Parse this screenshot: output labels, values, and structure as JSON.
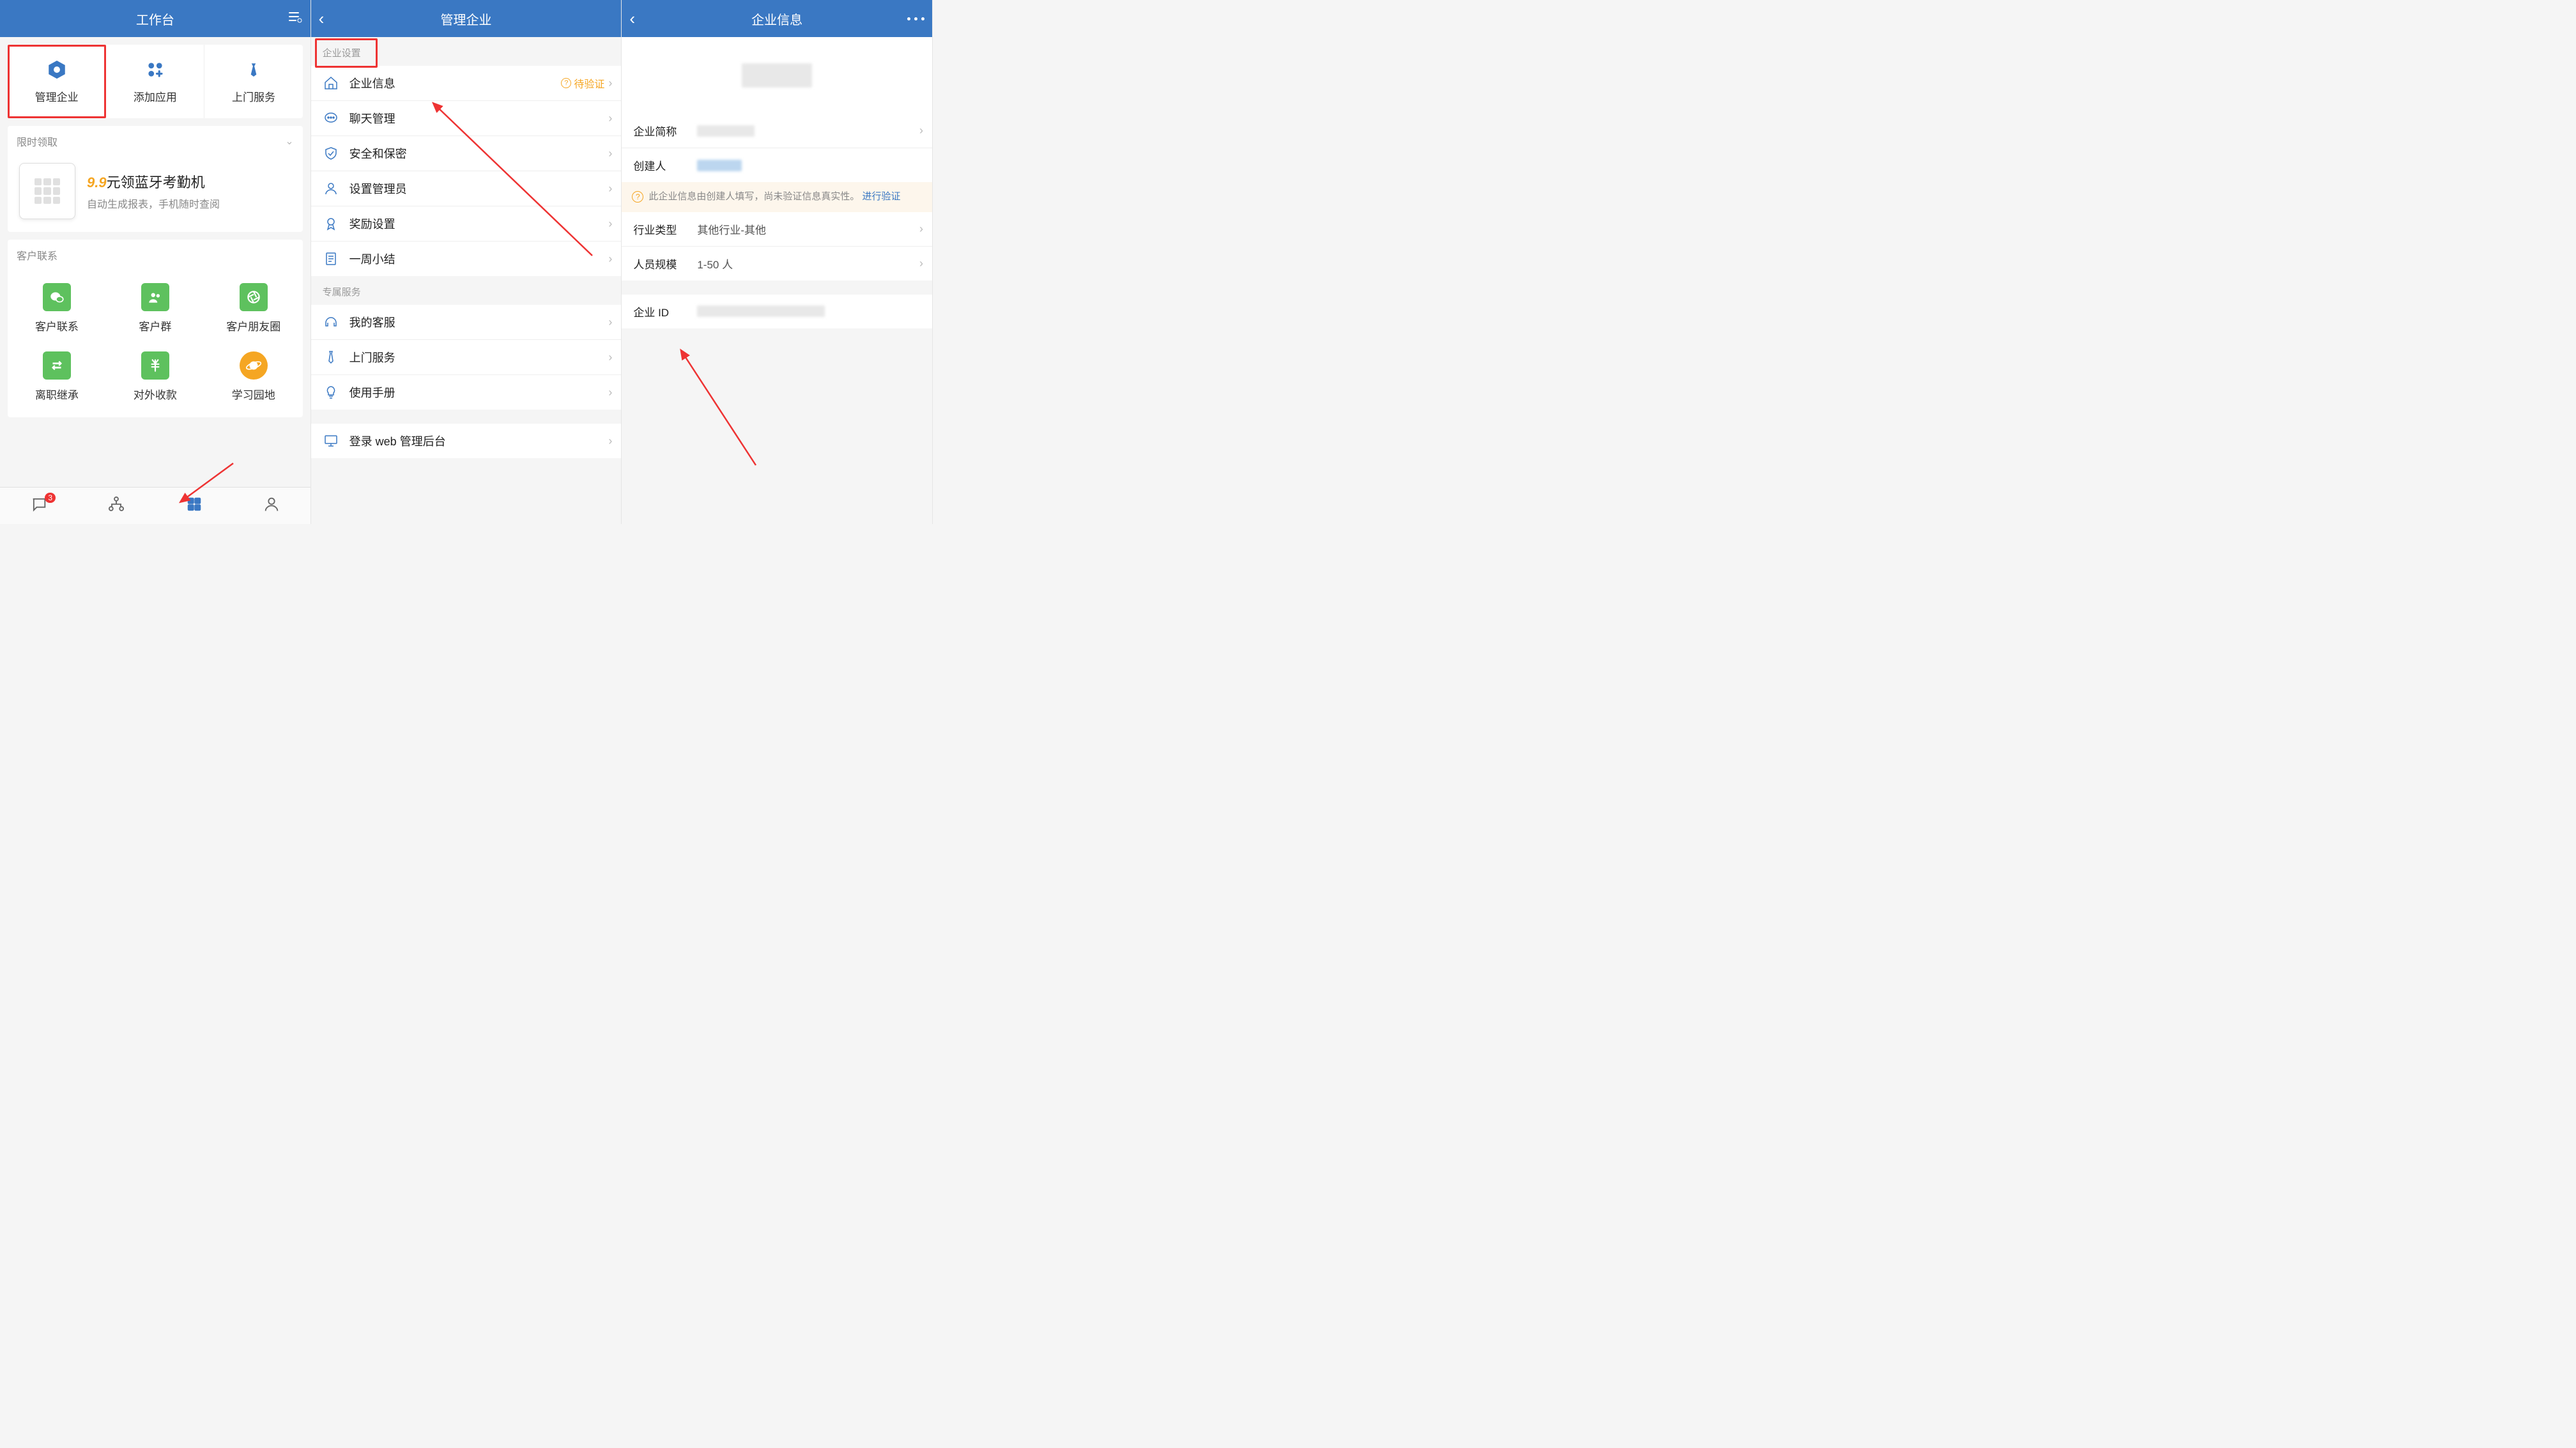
{
  "screen1": {
    "title": "工作台",
    "topGrid": [
      {
        "label": "管理企业",
        "icon": "gear-hex"
      },
      {
        "label": "添加应用",
        "icon": "add-app"
      },
      {
        "label": "上门服务",
        "icon": "tie"
      }
    ],
    "limited": {
      "header": "限时领取",
      "promoPrice": "9.9",
      "promoUnit": "元",
      "promoTitleRest": "领蓝牙考勤机",
      "promoSub": "自动生成报表，手机随时查阅"
    },
    "customer": {
      "header": "客户联系",
      "items": [
        {
          "label": "客户联系",
          "icon": "wechat",
          "color": "green"
        },
        {
          "label": "客户群",
          "icon": "group",
          "color": "green"
        },
        {
          "label": "客户朋友圈",
          "icon": "aperture",
          "color": "green"
        },
        {
          "label": "离职继承",
          "icon": "swap",
          "color": "green"
        },
        {
          "label": "对外收款",
          "icon": "cny",
          "color": "green"
        },
        {
          "label": "学习园地",
          "icon": "planet",
          "color": "orange"
        }
      ]
    },
    "badgeCount": "3"
  },
  "screen2": {
    "title": "管理企业",
    "groups": [
      {
        "label": "企业设置",
        "rows": [
          {
            "label": "企业信息",
            "icon": "home",
            "status": "待验证"
          },
          {
            "label": "聊天管理",
            "icon": "chat"
          },
          {
            "label": "安全和保密",
            "icon": "shield"
          },
          {
            "label": "设置管理员",
            "icon": "user"
          },
          {
            "label": "奖励设置",
            "icon": "medal"
          },
          {
            "label": "一周小结",
            "icon": "doc"
          }
        ]
      },
      {
        "label": "专属服务",
        "rows": [
          {
            "label": "我的客服",
            "icon": "headset"
          },
          {
            "label": "上门服务",
            "icon": "tie"
          },
          {
            "label": "使用手册",
            "icon": "bulb"
          }
        ]
      },
      {
        "label": "",
        "rows": [
          {
            "label": "登录 web 管理后台",
            "icon": "monitor"
          }
        ]
      }
    ]
  },
  "screen3": {
    "title": "企业信息",
    "rows1": [
      {
        "label": "企业简称",
        "valueBlur": true
      },
      {
        "label": "创建人",
        "valueBlur": true
      }
    ],
    "noticeText": "此企业信息由创建人填写，尚未验证信息真实性。",
    "noticeLink": "进行验证",
    "rows2": [
      {
        "label": "行业类型",
        "value": "其他行业-其他"
      },
      {
        "label": "人员规模",
        "value": "1-50 人"
      }
    ],
    "rows3": [
      {
        "label": "企业 ID",
        "valueBlur": true
      }
    ]
  }
}
